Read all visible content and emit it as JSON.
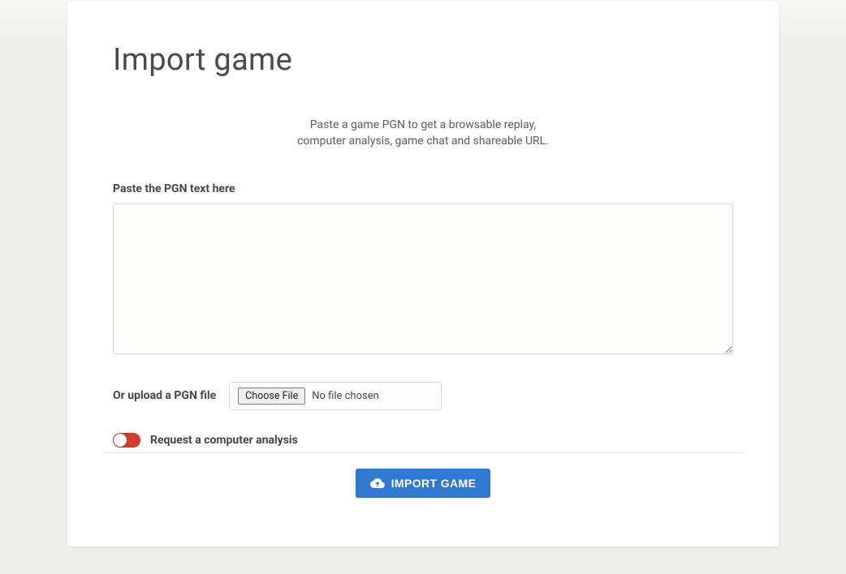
{
  "page": {
    "title": "Import game",
    "subtitle_line1": "Paste a game PGN to get a browsable replay,",
    "subtitle_line2": "computer analysis, game chat and shareable URL."
  },
  "form": {
    "pgn_label": "Paste the PGN text here",
    "pgn_value": "",
    "upload_label": "Or upload a PGN file",
    "choose_file_label": "Choose File",
    "file_status": "No file chosen",
    "analysis_toggle_label": "Request a computer analysis",
    "analysis_toggle_on": false,
    "submit_label": "IMPORT GAME"
  },
  "colors": {
    "accent": "#3079d1",
    "toggle_off_bg": "#d23b30",
    "body_bg": "#ededeb",
    "card_bg": "#ffffff"
  }
}
